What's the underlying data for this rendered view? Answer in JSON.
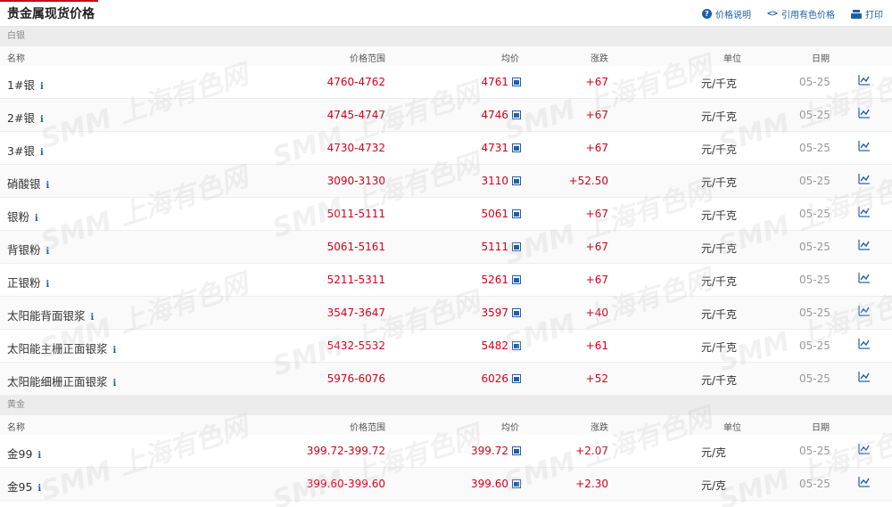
{
  "header": {
    "title": "贵金属现货价格",
    "actions": [
      {
        "label": "价格说明",
        "icon": "question-circle-icon"
      },
      {
        "label": "引用有色价格",
        "icon": "code-icon"
      },
      {
        "label": "打印",
        "icon": "printer-icon"
      }
    ]
  },
  "columns": {
    "name": "名称",
    "range": "价格范围",
    "avg": "均价",
    "change": "涨跌",
    "unit": "单位",
    "date": "日期"
  },
  "sections": [
    {
      "title": "白银",
      "rows": [
        {
          "name": "1#银",
          "range": "4760-4762",
          "avg": "4761",
          "change": "+67",
          "unit": "元/千克",
          "date": "05-25"
        },
        {
          "name": "2#银",
          "range": "4745-4747",
          "avg": "4746",
          "change": "+67",
          "unit": "元/千克",
          "date": "05-25"
        },
        {
          "name": "3#银",
          "range": "4730-4732",
          "avg": "4731",
          "change": "+67",
          "unit": "元/千克",
          "date": "05-25"
        },
        {
          "name": "硝酸银",
          "range": "3090-3130",
          "avg": "3110",
          "change": "+52.50",
          "unit": "元/千克",
          "date": "05-25"
        },
        {
          "name": "银粉",
          "range": "5011-5111",
          "avg": "5061",
          "change": "+67",
          "unit": "元/千克",
          "date": "05-25"
        },
        {
          "name": "背银粉",
          "range": "5061-5161",
          "avg": "5111",
          "change": "+67",
          "unit": "元/千克",
          "date": "05-25"
        },
        {
          "name": "正银粉",
          "range": "5211-5311",
          "avg": "5261",
          "change": "+67",
          "unit": "元/千克",
          "date": "05-25"
        },
        {
          "name": "太阳能背面银浆",
          "range": "3547-3647",
          "avg": "3597",
          "change": "+40",
          "unit": "元/千克",
          "date": "05-25"
        },
        {
          "name": "太阳能主栅正面银浆",
          "range": "5432-5532",
          "avg": "5482",
          "change": "+61",
          "unit": "元/千克",
          "date": "05-25"
        },
        {
          "name": "太阳能细栅正面银浆",
          "range": "5976-6076",
          "avg": "6026",
          "change": "+52",
          "unit": "元/千克",
          "date": "05-25"
        }
      ]
    },
    {
      "title": "黄金",
      "rows": [
        {
          "name": "金99",
          "range": "399.72-399.72",
          "avg": "399.72",
          "change": "+2.07",
          "unit": "元/克",
          "date": "05-25"
        },
        {
          "name": "金95",
          "range": "399.60-399.60",
          "avg": "399.60",
          "change": "+2.30",
          "unit": "元/克",
          "date": "05-25"
        }
      ]
    }
  ],
  "watermark": "SMM 上海有色网",
  "colors": {
    "accent": "#d0021b",
    "link": "#1f5fa8"
  }
}
